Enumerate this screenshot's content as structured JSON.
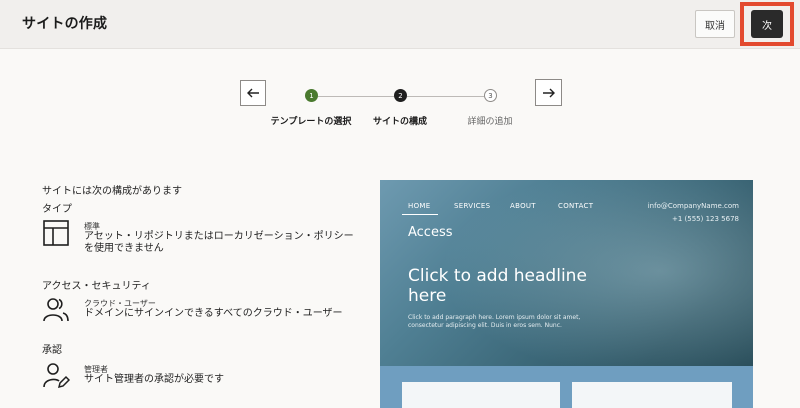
{
  "header": {
    "title": "サイトの作成",
    "cancel_label": "取消",
    "next_label": "次"
  },
  "stepper": {
    "steps": [
      {
        "number": "1",
        "label": "テンプレートの選択",
        "state": "complete"
      },
      {
        "number": "2",
        "label": "サイトの構成",
        "state": "current"
      },
      {
        "number": "3",
        "label": "詳細の追加",
        "state": "upcoming"
      }
    ],
    "prev_icon": "arrow-left-icon",
    "next_icon": "arrow-right-icon"
  },
  "config": {
    "intro": "サイトには次の構成があります",
    "sections": [
      {
        "heading": "タイプ",
        "icon": "layout-template-icon",
        "title": "標準",
        "description": "アセット・リポジトリまたはローカリゼーション・ポリシーを使用できません"
      },
      {
        "heading": "アクセス・セキュリティ",
        "icon": "users-icon",
        "title": "クラウド・ユーザー",
        "description": "ドメインにサインインできるすべてのクラウド・ユーザー"
      },
      {
        "heading": "承認",
        "icon": "user-edit-icon",
        "title": "管理者",
        "description": "サイト管理者の承認が必要です"
      }
    ]
  },
  "preview": {
    "nav": [
      "HOME",
      "SERVICES",
      "ABOUT",
      "CONTACT"
    ],
    "email": "info@CompanyName.com",
    "phone": "+1 (555) 123 5678",
    "access": "Access",
    "headline": "Click to add headline here",
    "paragraph": "Click to add paragraph here. Lorem ipsum dolor sit amet, consectetur adipiscing elit. Duis in eros sem. Nunc."
  },
  "colors": {
    "accent_highlight": "#e34a2f",
    "step_complete": "#4a7a2f",
    "step_current": "#1f1f1f"
  }
}
